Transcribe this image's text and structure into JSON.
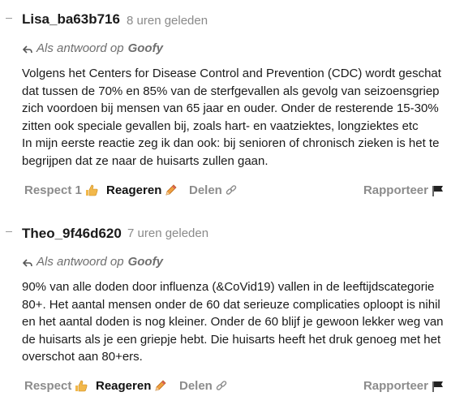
{
  "comments": [
    {
      "author": "Lisa_ba63b716",
      "time": "8 uren geleden",
      "reply_prefix": "Als antwoord op",
      "reply_target": "Goofy",
      "paragraphs": [
        "Volgens het Centers for Disease Control and Prevention (CDC) wordt geschat dat tussen de 70% en 85% van de sterfgevallen als gevolg van seizoensgriep zich voordoen bij mensen van 65 jaar en ouder. Onder de resterende 15-30% zitten ook speciale gevallen bij, zoals hart- en vaatziektes, longziektes etc",
        "In mijn eerste reactie zeg ik dan ook: bij senioren of chronisch zieken is het te begrijpen dat ze naar de huisarts zullen gaan."
      ],
      "respect_label": "Respect 1",
      "reply_label": "Reageren",
      "share_label": "Delen",
      "report_label": "Rapporteer"
    },
    {
      "author": "Theo_9f46d620",
      "time": "7 uren geleden",
      "reply_prefix": "Als antwoord op",
      "reply_target": "Goofy",
      "paragraphs": [
        "90% van alle doden door influenza (&CoVid19) vallen in de leeftijdscategorie 80+. Het aantal mensen onder de 60 dat serieuze complicaties oploopt is nihil en het aantal doden is nog kleiner. Onder de 60 blijf je gewoon lekker weg van de huisarts als je een griepje hebt. Die huisarts heeft het druk genoeg met het overschot aan 80+ers."
      ],
      "respect_label": "Respect",
      "reply_label": "Reageren",
      "share_label": "Delen",
      "report_label": "Rapporteer"
    }
  ],
  "icons": {
    "collapse": "minus-icon",
    "reply_arrow": "reply-arrow-icon",
    "thumbs_up": "thumbs-up-icon",
    "pencil": "pencil-icon",
    "link": "link-icon",
    "flag": "flag-icon"
  },
  "colors": {
    "muted": "#8c8c8c",
    "text": "#1a1a1a",
    "accent_thumb": "#f2b84b",
    "accent_pencil": "#e08a2a"
  }
}
